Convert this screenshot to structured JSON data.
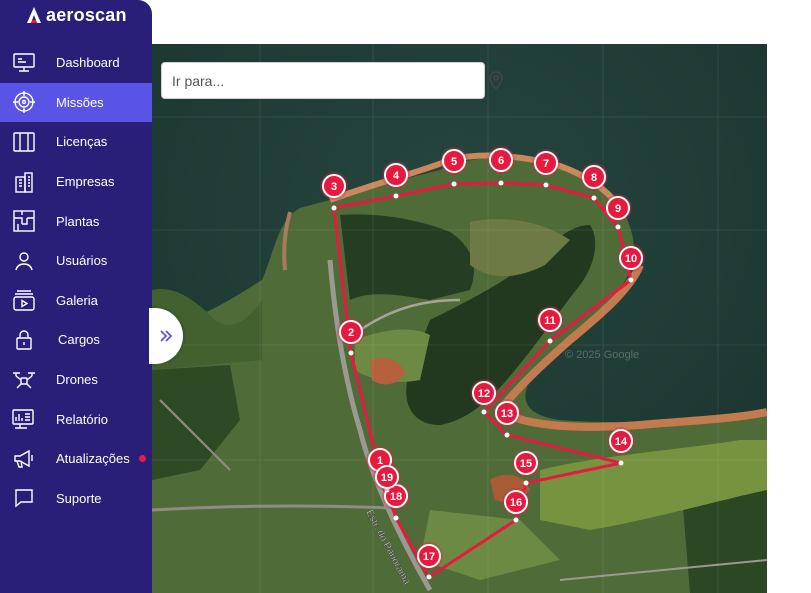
{
  "app": {
    "name": "aeroscan"
  },
  "sidebar": {
    "items": [
      {
        "label": "Dashboard",
        "icon": "monitor-icon",
        "active": false
      },
      {
        "label": "Missões",
        "icon": "target-icon",
        "active": true
      },
      {
        "label": "Licenças",
        "icon": "columns-icon",
        "active": false
      },
      {
        "label": "Empresas",
        "icon": "building-icon",
        "active": false
      },
      {
        "label": "Plantas",
        "icon": "blueprint-icon",
        "active": false
      },
      {
        "label": "Usuários",
        "icon": "user-icon",
        "active": false
      },
      {
        "label": "Galeria",
        "icon": "gallery-icon",
        "active": false
      },
      {
        "label": "Cargos",
        "icon": "lock-icon",
        "active": false
      },
      {
        "label": "Drones",
        "icon": "drone-icon",
        "active": false
      },
      {
        "label": "Relatório",
        "icon": "report-icon",
        "active": false
      },
      {
        "label": "Atualizações",
        "icon": "megaphone-icon",
        "active": false,
        "badge": true
      },
      {
        "label": "Suporte",
        "icon": "chat-icon",
        "active": false
      }
    ]
  },
  "map": {
    "search_placeholder": "Ir para...",
    "watermark": "© 2025 Google",
    "road_label": "Estr. do Panorama",
    "route_color": "#e8193f",
    "waypoints": [
      "1",
      "2",
      "3",
      "4",
      "5",
      "6",
      "7",
      "8",
      "9",
      "10",
      "11",
      "12",
      "13",
      "14",
      "15",
      "16",
      "17",
      "18",
      "19"
    ]
  },
  "colors": {
    "sidebar": "#2a1f78",
    "active": "#5a54e6",
    "accent": "#e8193f",
    "water": "#1f3e36"
  }
}
